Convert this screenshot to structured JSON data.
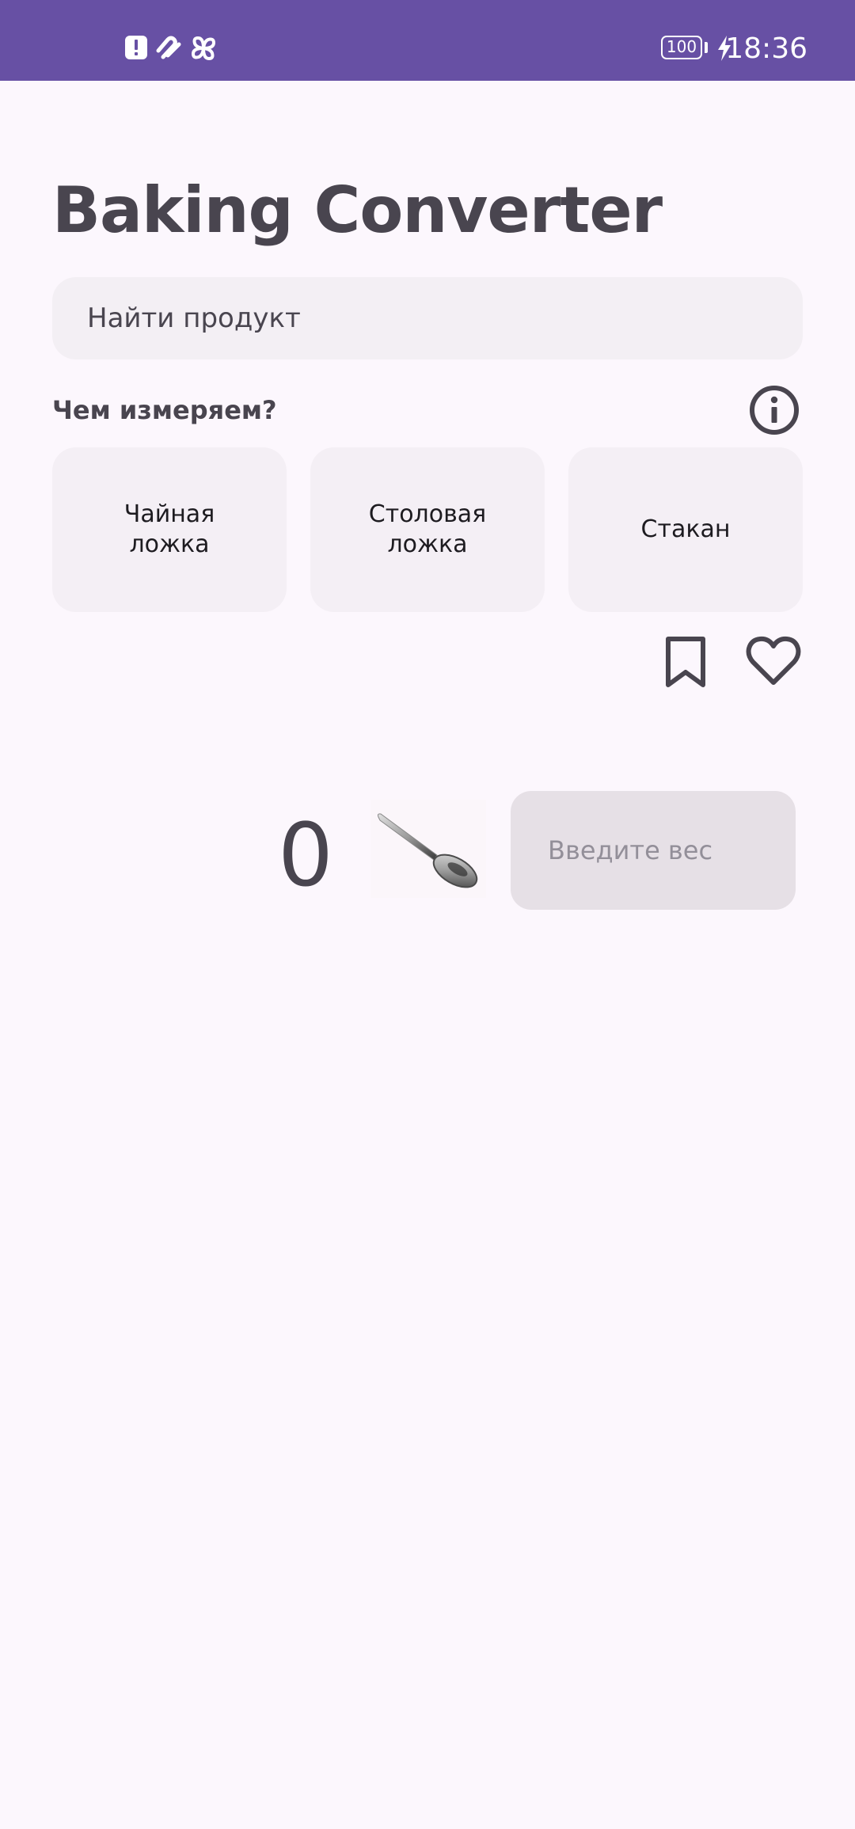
{
  "status_bar": {
    "time": "18:36",
    "battery": "100",
    "icons": [
      "alert-icon",
      "health-icon",
      "pinwheel-icon",
      "battery-icon",
      "charging-bolt-icon"
    ],
    "background": "#6750A4"
  },
  "app": {
    "title": "Baking Converter"
  },
  "search": {
    "placeholder": "Найти продукт"
  },
  "measure": {
    "label": "Чем измеряем?",
    "options": [
      {
        "label": "Чайная\nложка"
      },
      {
        "label": "Столовая\nложка"
      },
      {
        "label": "Стакан"
      }
    ],
    "info_icon": "info-icon"
  },
  "actions": {
    "bookmark_icon": "bookmark-icon",
    "heart_icon": "heart-icon"
  },
  "result": {
    "value": "0",
    "unit_image": "spoon-icon"
  },
  "weight": {
    "placeholder": "Введите вес"
  },
  "colors": {
    "background": "#FCF7FD",
    "surface": "#F3EFF4",
    "input_fill": "#E6E0E6",
    "text": "#49454F",
    "accent": "#6750A4"
  }
}
